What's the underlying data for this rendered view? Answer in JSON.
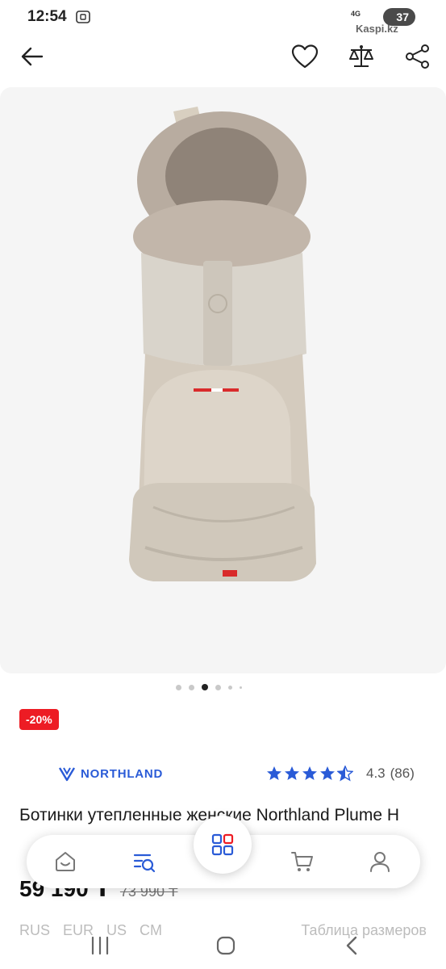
{
  "status_bar": {
    "time": "12:54",
    "network": "4G",
    "battery": "37",
    "watermark": "Kaspi.kz"
  },
  "nav": {
    "back_icon": "arrow-left-icon",
    "favorite_icon": "heart-icon",
    "compare_icon": "scales-icon",
    "share_icon": "share-icon"
  },
  "gallery": {
    "total_dots": 6,
    "active_index": 2
  },
  "product": {
    "discount": "-20%",
    "brand": "NORTHLAND",
    "rating_value": "4.3",
    "rating_count": "(86)",
    "rating_stars": 4.3,
    "title": "Ботинки утепленные женские Northland Plume H",
    "price_current": "59 190 ₸",
    "price_old": "73 990 ₸"
  },
  "sizes": {
    "tabs": [
      "RUS",
      "EUR",
      "US",
      "CM"
    ],
    "table_link": "Таблица размеров"
  },
  "bottom_nav": {
    "items": [
      "home-icon",
      "catalog-search-icon",
      "grid-icon",
      "cart-icon",
      "profile-icon"
    ],
    "accent_color": "#2a5bd7"
  },
  "colors": {
    "discount_red": "#ed1c24",
    "brand_blue": "#2a5bd7",
    "star_blue": "#2a5bd7"
  }
}
